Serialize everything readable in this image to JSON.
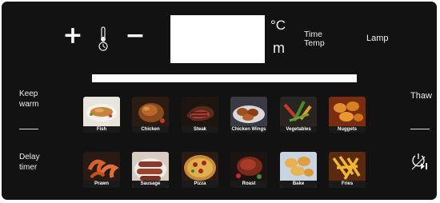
{
  "controls": {
    "plus_label": "+",
    "minus_label": "−",
    "thermometer_icon": "thermometer-icon",
    "celsius_label": "°C",
    "minutes_label": "m",
    "time_temp_line1": "Time",
    "time_temp_line2": "Temp",
    "lamp_label": "Lamp"
  },
  "left": {
    "keep_warm_line1": "Keep",
    "keep_warm_line2": "warm",
    "delay_timer_line1": "Delay",
    "delay_timer_line2": "timer"
  },
  "right": {
    "thaw_label": "Thaw",
    "power_icon": "power-play-pause-icon"
  },
  "programs_row1": [
    {
      "label": "Fish",
      "icon": "fish-photo"
    },
    {
      "label": "Chicken",
      "icon": "chicken-photo"
    },
    {
      "label": "Steak",
      "icon": "steak-photo"
    },
    {
      "label": "Chicken Wings",
      "icon": "chicken-wings-photo"
    },
    {
      "label": "Vegetables",
      "icon": "vegetables-photo"
    },
    {
      "label": "Nuggets",
      "icon": "nuggets-photo"
    }
  ],
  "programs_row2": [
    {
      "label": "Prawn",
      "icon": "prawn-photo"
    },
    {
      "label": "Sausage",
      "icon": "sausage-photo"
    },
    {
      "label": "Pizza",
      "icon": "pizza-photo"
    },
    {
      "label": "Roast",
      "icon": "roast-photo"
    },
    {
      "label": "Bake",
      "icon": "bake-photo"
    },
    {
      "label": "Fries",
      "icon": "fries-photo"
    }
  ],
  "colors": {
    "panel": "#121212",
    "display": "#ffffff",
    "text": "#f0f0f0"
  }
}
